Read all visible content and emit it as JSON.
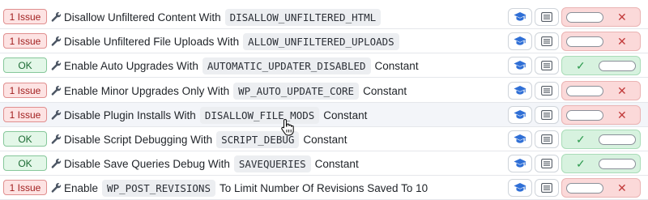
{
  "rows": [
    {
      "status": "1 Issue",
      "status_type": "issue",
      "prefix": "Disallow Unfiltered Content With",
      "code": "DISALLOW_UNFILTERED_HTML",
      "suffix": "",
      "toggle": "off",
      "toggle_symbol": "✕",
      "hover": false
    },
    {
      "status": "1 Issue",
      "status_type": "issue",
      "prefix": "Disable Unfiltered File Uploads With",
      "code": "ALLOW_UNFILTERED_UPLOADS",
      "suffix": "",
      "toggle": "off",
      "toggle_symbol": "✕",
      "hover": false
    },
    {
      "status": "OK",
      "status_type": "ok",
      "prefix": "Enable Auto Upgrades With",
      "code": "AUTOMATIC_UPDATER_DISABLED",
      "suffix": "Constant",
      "toggle": "on",
      "toggle_symbol": "✓",
      "hover": false
    },
    {
      "status": "1 Issue",
      "status_type": "issue",
      "prefix": "Enable Minor Upgrades Only With",
      "code": "WP_AUTO_UPDATE_CORE",
      "suffix": "Constant",
      "toggle": "off",
      "toggle_symbol": "✕",
      "hover": false
    },
    {
      "status": "1 Issue",
      "status_type": "issue",
      "prefix": "Disable Plugin Installs With",
      "code": "DISALLOW_FILE_MODS",
      "suffix": "Constant",
      "toggle": "off",
      "toggle_symbol": "✕",
      "hover": true
    },
    {
      "status": "OK",
      "status_type": "ok",
      "prefix": "Disable Script Debugging With",
      "code": "SCRIPT_DEBUG",
      "suffix": "Constant",
      "toggle": "on",
      "toggle_symbol": "✓",
      "hover": false
    },
    {
      "status": "OK",
      "status_type": "ok",
      "prefix": "Disable Save Queries Debug With",
      "code": "SAVEQUERIES",
      "suffix": "Constant",
      "toggle": "on",
      "toggle_symbol": "✓",
      "hover": false
    },
    {
      "status": "1 Issue",
      "status_type": "issue",
      "prefix": "Enable",
      "code": "WP_POST_REVISIONS",
      "suffix": "To Limit Number Of Revisions Saved To 10",
      "toggle": "off",
      "toggle_symbol": "✕",
      "hover": false
    }
  ],
  "icons": {
    "wrench": "wrench-icon",
    "learn": "graduation-cap-icon",
    "doc": "list-document-icon",
    "cursor": "hand-pointer-icon"
  },
  "colors": {
    "issue_bg": "#fde3e3",
    "ok_bg": "#e3f7e8",
    "learn_icon": "#2f6fd6",
    "toggle_off": "#fbd9d9",
    "toggle_on": "#d7f2df"
  }
}
